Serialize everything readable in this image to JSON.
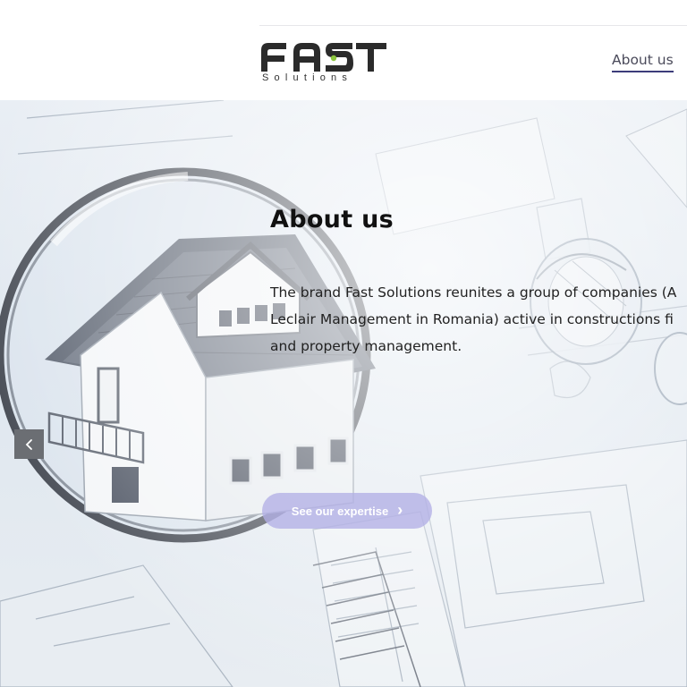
{
  "header": {
    "logo": {
      "word": "FAST",
      "tagline": "Solutions"
    },
    "nav": [
      {
        "label": "About us"
      }
    ]
  },
  "hero": {
    "title": "About us",
    "text_lines": [
      "The brand Fast Solutions reunites a group of companies (A",
      "Leclair Management in Romania) active in constructions fi",
      "and property management."
    ],
    "cta": {
      "label": "See our expertise",
      "icon": "chevron-right-icon"
    },
    "prev": {
      "icon": "chevron-left-icon"
    }
  },
  "colors": {
    "accent": "#3c3c7a",
    "cta_bg": "#b2b0e6",
    "logo_green": "#8cc63f",
    "prev_bg": "#6b6e73"
  }
}
